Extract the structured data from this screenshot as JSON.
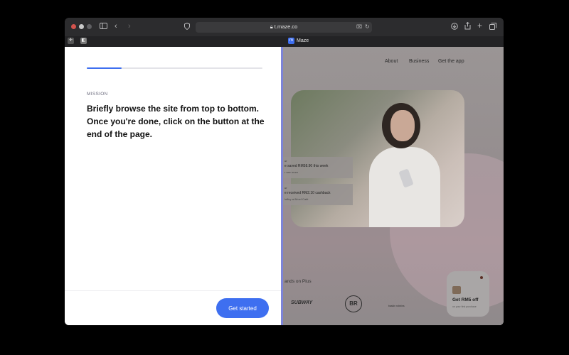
{
  "browser": {
    "url": "t.maze.co",
    "tab_title": "Maze",
    "colors": {
      "close": "#ff5f57",
      "minimize": "#c8c8c8",
      "zoom": "#5f5f62"
    }
  },
  "panel": {
    "progress": 0.2,
    "mission_label": "MISSION",
    "mission_text": "Briefly browse the site from top to bottom. Once you're done, click on the button at the end of the page.",
    "button_label": "Get started",
    "accent_color": "#3e6ff0"
  },
  "site": {
    "nav": [
      "About",
      "Business",
      "Get the app"
    ],
    "notifications": [
      {
        "small": "ur",
        "main": "e saved RM58.90 this week",
        "sub": "r see more"
      },
      {
        "small": "ur",
        "main": "e received RM2.10 cashback",
        "sub": "loffey at Moef Café"
      }
    ],
    "brands_label": "ands on Plus",
    "brands": [
      "SUBWAY",
      "BR",
      "baskin robbins"
    ],
    "promo": {
      "title": "Get RM5 off",
      "sub": "on your first purchase"
    }
  }
}
